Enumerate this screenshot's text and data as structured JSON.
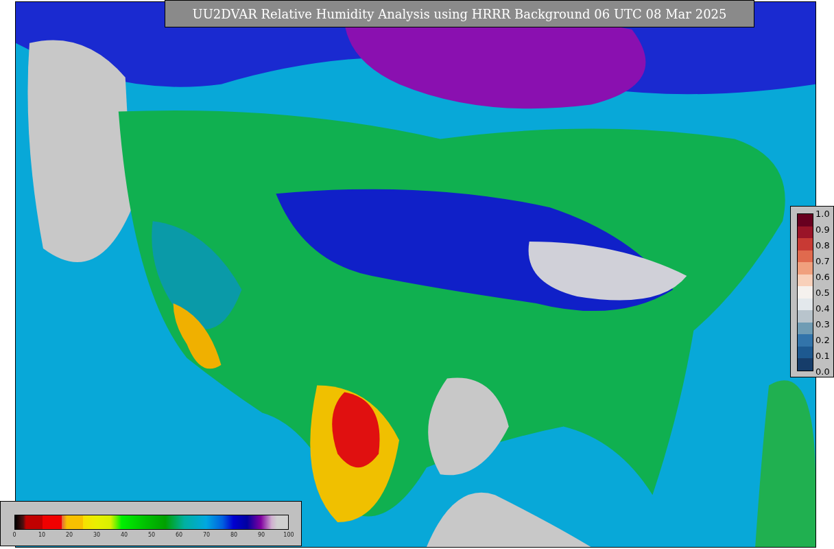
{
  "title": "UU2DVAR Relative Humidity Analysis using HRRR Background 06 UTC 08 Mar 2025",
  "humidity_legend": {
    "ticks": [
      "0",
      "10",
      "20",
      "30",
      "40",
      "50",
      "60",
      "70",
      "80",
      "90",
      "100"
    ]
  },
  "station_legend": {
    "ticks": [
      "1.0",
      "0.9",
      "0.8",
      "0.7",
      "0.6",
      "0.5",
      "0.4",
      "0.3",
      "0.2",
      "0.1",
      "0.0"
    ],
    "swatches": [
      {
        "color": "#67001f"
      },
      {
        "color": "#9a1428"
      },
      {
        "color": "#c83a34"
      },
      {
        "color": "#e06a4e"
      },
      {
        "color": "#f0a07e"
      },
      {
        "color": "#f8d0ba"
      },
      {
        "color": "#f5f1ee"
      },
      {
        "color": "#e3e8ec"
      },
      {
        "color": "#b8c4cc"
      },
      {
        "color": "#6f9cb4"
      },
      {
        "color": "#3274aa"
      },
      {
        "color": "#1d5990"
      },
      {
        "color": "#163d6a"
      }
    ]
  }
}
